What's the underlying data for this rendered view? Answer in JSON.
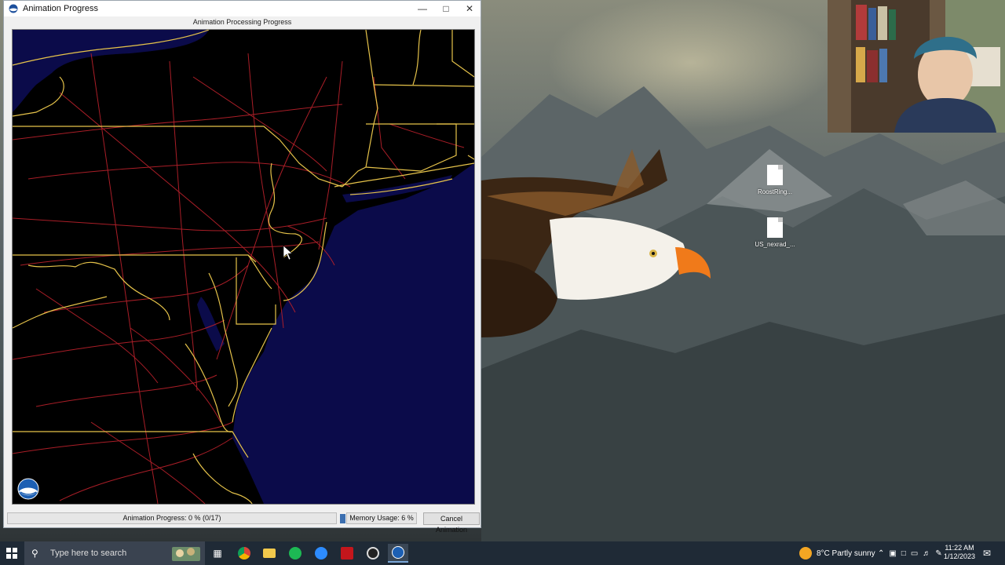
{
  "window": {
    "title": "Animation Progress",
    "header": "Animation Processing Progress",
    "progress_text": "Animation Progress: 0 % (0/17)",
    "progress_fraction": 0,
    "memory_text": "Memory Usage: 6 %",
    "memory_fraction": 0.06,
    "cancel_label": "Cancel Animation"
  },
  "desktop_icons": [
    {
      "label": "RoostRing..."
    },
    {
      "label": "US_nexrad_..."
    }
  ],
  "taskbar": {
    "search_placeholder": "Type here to search",
    "weather": "8°C  Partly sunny",
    "time": "11:22 AM",
    "date": "1/12/2023"
  },
  "colors": {
    "map_background": "#000000",
    "ocean": "#0b0b4a",
    "state_borders": "#e6c34a",
    "roads": "#c1272d",
    "taskbar": "#1f2a36"
  }
}
